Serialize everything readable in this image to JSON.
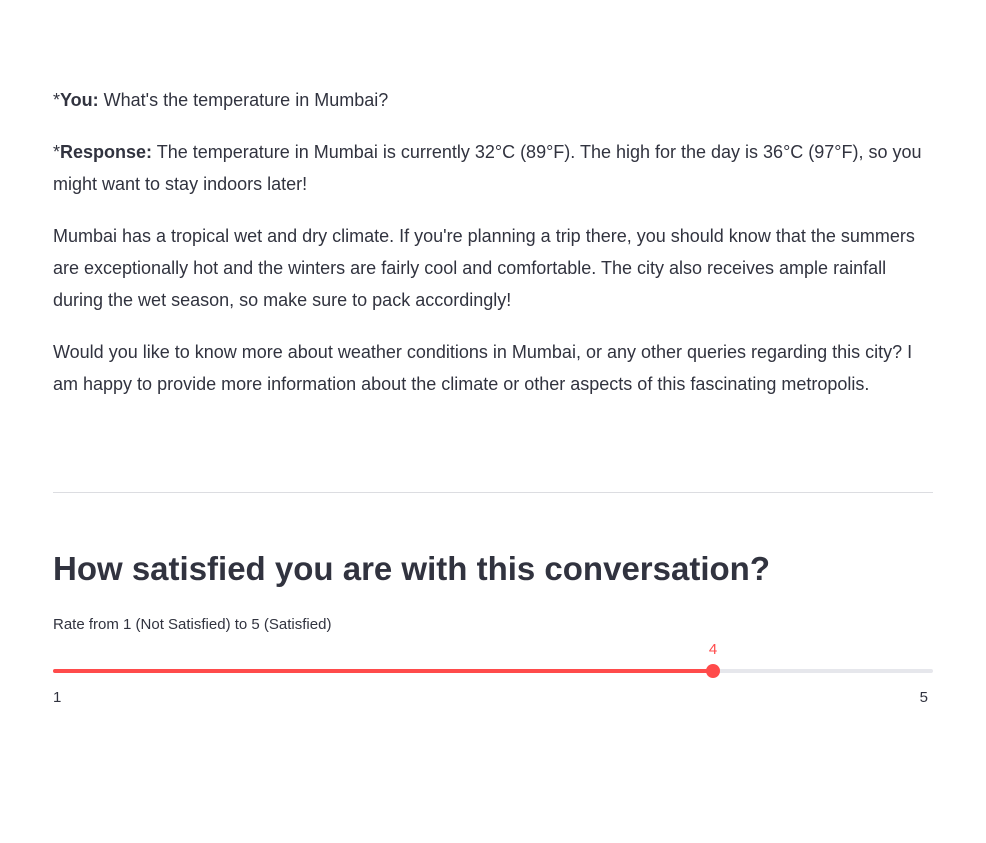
{
  "conversation": {
    "user_prefix": "*",
    "user_label": "You:",
    "user_text": " What's the temperature in Mumbai?",
    "response_prefix": "*",
    "response_label": "Response:",
    "response_text": " The temperature in Mumbai is currently 32°C (89°F). The high for the day is 36°C (97°F), so you might want to stay indoors later!",
    "paragraph_2": "Mumbai has a tropical wet and dry climate. If you're planning a trip there, you should know that the summers are exceptionally hot and the winters are fairly cool and comfortable. The city also receives ample rainfall during the wet season, so make sure to pack accordingly!",
    "paragraph_3": "Would you like to know more about weather conditions in Mumbai, or any other queries regarding this city? I am happy to provide more information about the climate or other aspects of this fascinating metropolis."
  },
  "feedback": {
    "heading": "How satisfied you are with this conversation?",
    "slider_label": "Rate from 1 (Not Satisfied) to 5 (Satisfied)",
    "min": 1,
    "max": 5,
    "value": 4,
    "min_label": "1",
    "max_label": "5",
    "value_label": "4",
    "accent_color": "#ff4b4b",
    "track_color": "#e6e7ec"
  }
}
